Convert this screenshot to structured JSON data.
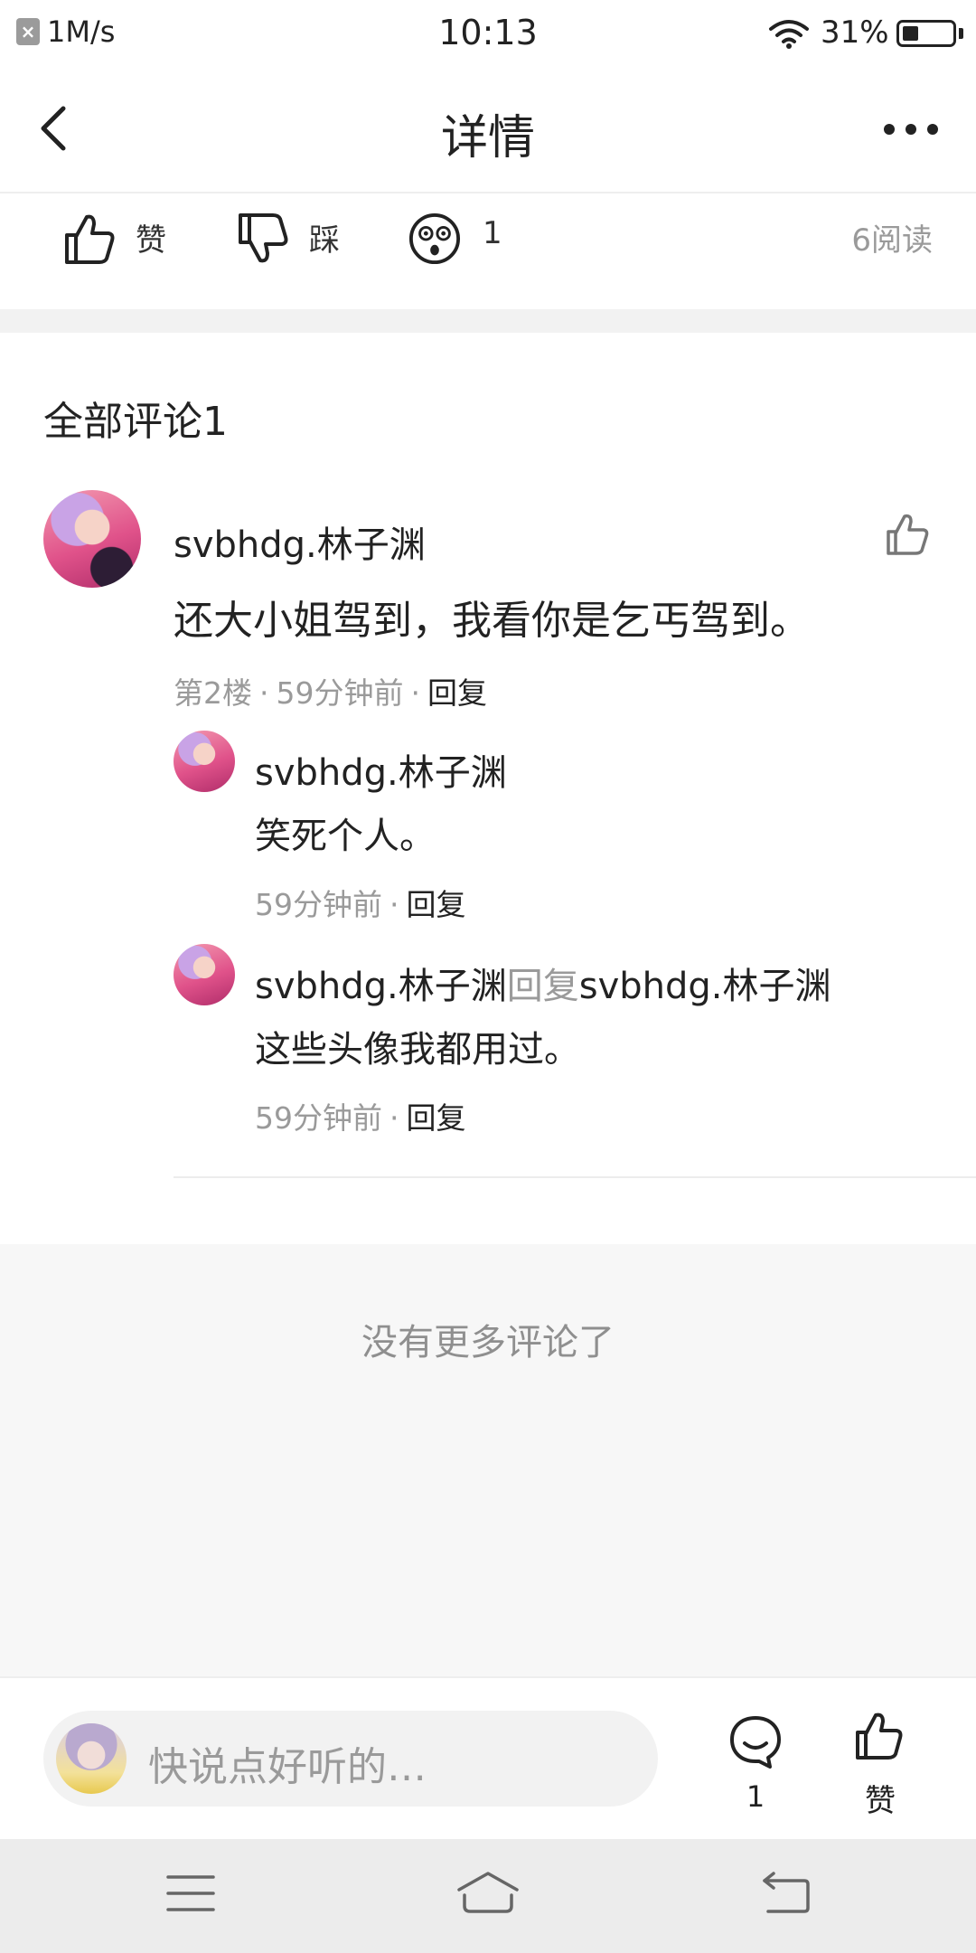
{
  "status_bar": {
    "net_icon": "x-box-icon",
    "net_speed": "1M/s",
    "time": "10:13",
    "battery_percent": "31%",
    "battery_level": 0.31
  },
  "header": {
    "back_icon": "chevron-left-icon",
    "title": "详情",
    "more_icon": "more-dots-icon"
  },
  "actions": {
    "like_label": "赞",
    "dislike_label": "踩",
    "emoji_count": "1",
    "read_count": "6阅读"
  },
  "comments": {
    "title": "全部评论1",
    "main": {
      "username": "svbhdg.林子渊",
      "text": "还大小姐驾到，我看你是乞丐驾到。",
      "floor": "第2楼",
      "time": "59分钟前",
      "reply_label": "回复"
    },
    "replies": [
      {
        "username": "svbhdg.林子渊",
        "reply_word": "",
        "target": "",
        "text": "笑死个人。",
        "time": "59分钟前",
        "reply_label": "回复"
      },
      {
        "username": "svbhdg.林子渊",
        "reply_word": "回复",
        "target": "svbhdg.林子渊",
        "text": "这些头像我都用过。",
        "time": "59分钟前",
        "reply_label": "回复"
      }
    ],
    "no_more": "没有更多评论了"
  },
  "bottom_bar": {
    "input_placeholder": "快说点好听的…",
    "comment_count": "1",
    "like_label": "赞"
  },
  "colors": {
    "text_primary": "#222222",
    "text_secondary": "#9a9a9a",
    "page_gray": "#f7f7f7",
    "system_nav": "#ececec"
  }
}
